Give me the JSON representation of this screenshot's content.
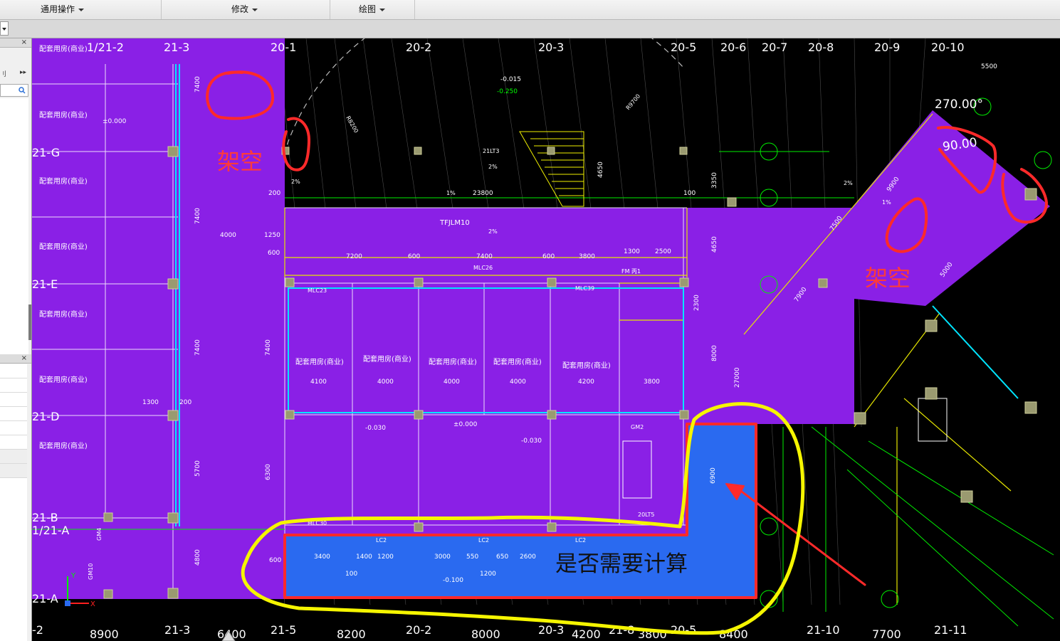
{
  "menubar": {
    "items": [
      {
        "label": "通用操作"
      },
      {
        "label": "修改"
      },
      {
        "label": "绘图"
      }
    ]
  },
  "left_panel": {
    "close_glyph": "×",
    "arrows_glyph": "▸▸",
    "fragment_label": "刂"
  },
  "grid_labels": {
    "top": [
      "1/21-2",
      "21-3",
      "20-1",
      "20-2",
      "20-3",
      "20-5",
      "20-6",
      "20-7",
      "20-8",
      "20-9",
      "20-10"
    ],
    "left": [
      "21-G",
      "21-E",
      "21-D",
      "21-B",
      "1/21-A",
      "21-A"
    ],
    "bottom": [
      "-2",
      "8900",
      "21-3",
      "6400",
      "21-5",
      "8200",
      "20-2",
      "8000",
      "20-3",
      "4200",
      "21-8",
      "3800",
      "20-5",
      "8400",
      "21-10",
      "7700",
      "21-11"
    ]
  },
  "annotations": {
    "open_space_1": "架空",
    "open_space_2": "架空",
    "question": "是否需要计算",
    "angle_1": "270.00°",
    "angle_2": "90.00"
  },
  "room_label": "配套用房(商业)",
  "dims": {
    "d5500": "5500",
    "d23800": "23800",
    "d7200": "7200",
    "d7400": "7400",
    "d3800": "3800",
    "d1300": "1300",
    "d2500": "2500",
    "d4000": "4000",
    "d1250": "1250",
    "d4100": "4100",
    "d4200": "4200",
    "d8000": "8000",
    "d27000": "27000",
    "d6900": "6900",
    "d3400": "3400",
    "d1400": "1400",
    "d1200": "1200",
    "d3000": "3000",
    "d550": "550",
    "d650": "650",
    "d2600": "2600",
    "d100": "100",
    "d600": "600",
    "d200": "200",
    "d4650": "4650",
    "d3350": "3350",
    "d2300": "2300",
    "d7900": "7900",
    "d9900": "9900",
    "d7500": "7500",
    "d5000": "5000",
    "d4800": "4800",
    "d5700": "5700",
    "d6300": "6300",
    "lvl1": "-0.015",
    "lvl2": "-0.250",
    "lvl3": "±0.000",
    "lvl4": "-0.030",
    "lvl5": "-0.100",
    "tfjlm": "TFJLM10",
    "mlc26": "MLC26",
    "mlc23": "MLC23",
    "mlc39": "MLC39",
    "mlc30": "MLC30",
    "lc2": "LC2",
    "lt3": "21LT3",
    "lt5": "20LT5",
    "fm": "FM 丙1",
    "gm4": "GM4",
    "gm2": "GM2",
    "gm10": "GM10",
    "pct": "2%",
    "pct1": "1%",
    "r8200": "R8200",
    "r9700": "R9700"
  },
  "colors": {
    "purple": "#8a20e6",
    "blue": "#2a6af0",
    "red": "#ff2a2a",
    "yellow": "#f5f500",
    "black": "#000000",
    "green": "#00ff00",
    "white_line": "#ffffff"
  }
}
